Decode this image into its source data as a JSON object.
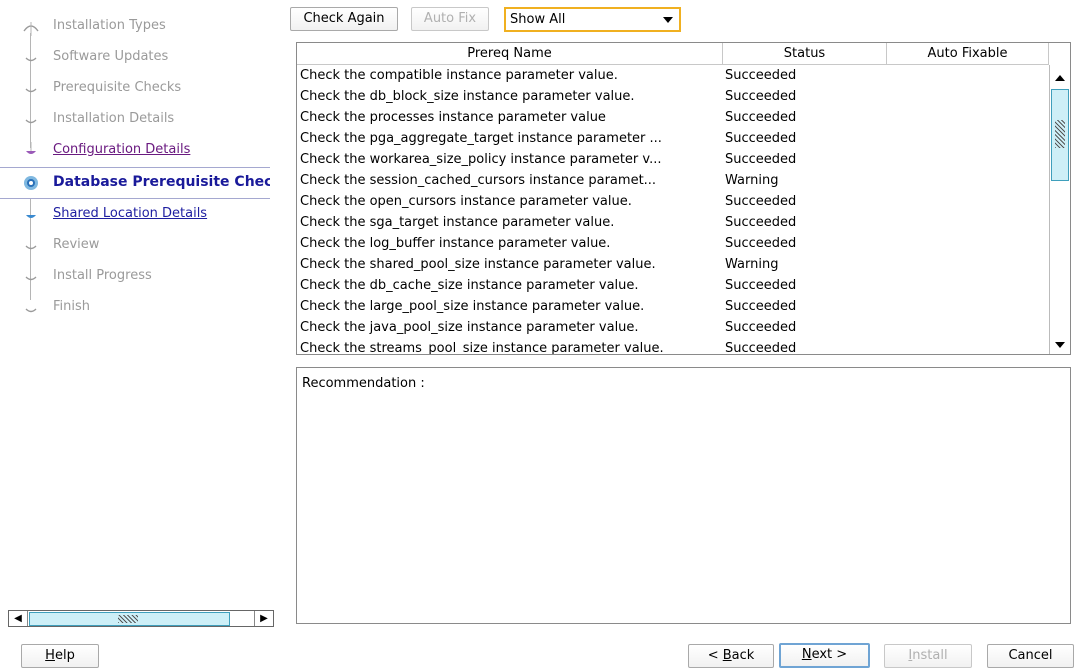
{
  "steps": [
    {
      "label": "Installation Types",
      "state": "disabled"
    },
    {
      "label": "Software Updates",
      "state": "disabled"
    },
    {
      "label": "Prerequisite Checks",
      "state": "disabled"
    },
    {
      "label": "Installation Details",
      "state": "disabled"
    },
    {
      "label": "Configuration Details",
      "state": "visited"
    },
    {
      "label": "Database Prerequisite Checks",
      "state": "current"
    },
    {
      "label": "Shared Location Details",
      "state": "link"
    },
    {
      "label": "Review",
      "state": "disabled"
    },
    {
      "label": "Install Progress",
      "state": "disabled"
    },
    {
      "label": "Finish",
      "state": "disabled"
    }
  ],
  "toolbar": {
    "check_again_label": "Check Again",
    "auto_fix_label": "Auto Fix",
    "filter_value": "Show All"
  },
  "table": {
    "columns": [
      "Prereq Name",
      "Status",
      "Auto Fixable"
    ],
    "rows": [
      {
        "name": "Check the compatible instance parameter value.",
        "status": "Succeeded",
        "fixable": ""
      },
      {
        "name": "Check the db_block_size instance parameter value.",
        "status": "Succeeded",
        "fixable": ""
      },
      {
        "name": "Check the processes instance parameter value",
        "status": "Succeeded",
        "fixable": ""
      },
      {
        "name": "Check the pga_aggregate_target instance parameter ...",
        "status": "Succeeded",
        "fixable": ""
      },
      {
        "name": "Check the workarea_size_policy instance parameter v...",
        "status": "Succeeded",
        "fixable": ""
      },
      {
        "name": "Check the session_cached_cursors instance paramet...",
        "status": "Warning",
        "fixable": ""
      },
      {
        "name": "Check the open_cursors instance parameter value.",
        "status": "Succeeded",
        "fixable": ""
      },
      {
        "name": "Check the sga_target instance parameter value.",
        "status": "Succeeded",
        "fixable": ""
      },
      {
        "name": "Check the log_buffer instance parameter value.",
        "status": "Succeeded",
        "fixable": ""
      },
      {
        "name": "Check the shared_pool_size instance parameter value.",
        "status": "Warning",
        "fixable": ""
      },
      {
        "name": "Check the db_cache_size instance parameter value.",
        "status": "Succeeded",
        "fixable": ""
      },
      {
        "name": "Check the large_pool_size instance parameter value.",
        "status": "Succeeded",
        "fixable": ""
      },
      {
        "name": "Check the java_pool_size instance parameter value.",
        "status": "Succeeded",
        "fixable": ""
      },
      {
        "name": "Check the streams_pool_size instance parameter value.",
        "status": "Succeeded",
        "fixable": ""
      }
    ]
  },
  "recommendation_label": "Recommendation :",
  "footer": {
    "help": {
      "mnemonic": "H",
      "rest": "elp"
    },
    "back": {
      "prefix": "< ",
      "mnemonic": "B",
      "rest": "ack"
    },
    "next": {
      "mnemonic": "N",
      "rest": "ext >"
    },
    "install": {
      "mnemonic": "I",
      "rest": "nstall"
    },
    "cancel": "Cancel"
  }
}
